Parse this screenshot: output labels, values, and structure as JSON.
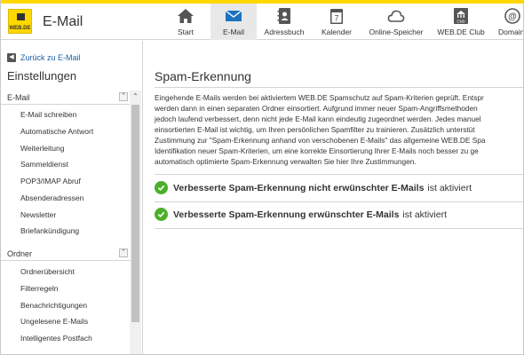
{
  "header": {
    "logo_text": "WEB.DE",
    "app_title": "E-Mail",
    "nav": [
      {
        "label": "Start",
        "icon": "home-icon"
      },
      {
        "label": "E-Mail",
        "icon": "mail-icon",
        "active": true
      },
      {
        "label": "Adressbuch",
        "icon": "addressbook-icon"
      },
      {
        "label": "Kalender",
        "icon": "calendar-icon",
        "text": "7"
      },
      {
        "label": "Online-Speicher",
        "icon": "cloud-icon"
      },
      {
        "label": "WEB.DE Club",
        "icon": "club-icon",
        "text": "Club"
      },
      {
        "label": "Domain",
        "icon": "domain-icon"
      }
    ]
  },
  "sidebar": {
    "back_label": "Zurück zu E-Mail",
    "title": "Einstellungen",
    "sections": [
      {
        "label": "E-Mail",
        "items": [
          "E-Mail schreiben",
          "Automatische Antwort",
          "Weiterleitung",
          "Sammeldienst",
          "POP3/IMAP Abruf",
          "Absenderadressen",
          "Newsletter",
          "Briefankündigung"
        ]
      },
      {
        "label": "Ordner",
        "items": [
          "Ordnerübersicht",
          "Filterregeln",
          "Benachrichtigungen",
          "Ungelesene E-Mails",
          "Intelligentes Postfach"
        ]
      }
    ]
  },
  "main": {
    "title": "Spam-Erkennung",
    "description": [
      "Eingehende E-Mails werden bei aktiviertem WEB.DE Spamschutz auf Spam-Kriterien geprüft. Entspr",
      "werden dann in einen separaten Ordner einsortiert. Aufgrund immer neuer Spam-Angriffsmethoden",
      "jedoch laufend verbessert, denn nicht jede E-Mail kann eindeutig zugeordnet werden. Jedes manuel",
      "einsortierten E-Mail ist wichtig, um Ihren persönlichen Spamfilter zu trainieren. Zusätzlich unterstüt",
      "Zustimmung zur \"Spam-Erkennung anhand von verschobenen E-Mails\" das allgemeine WEB.DE Spa",
      "Identifikation neuer Spam-Kriterien, um eine korrekte Einsortierung Ihrer E-Mails noch besser zu ge",
      "automatisch optimierte Spam-Erkennung verwalten Sie hier Ihre Zustimmungen."
    ],
    "statuses": [
      {
        "bold": "Verbesserte Spam-Erkennung nicht erwünschter E-Mails",
        "suffix": "ist aktiviert"
      },
      {
        "bold": "Verbesserte Spam-Erkennung erwünschter E-Mails",
        "suffix": "ist aktiviert"
      }
    ]
  },
  "colors": {
    "brand_yellow": "#ffd800",
    "link_blue": "#1e5fa8",
    "check_green": "#4caf2a"
  }
}
